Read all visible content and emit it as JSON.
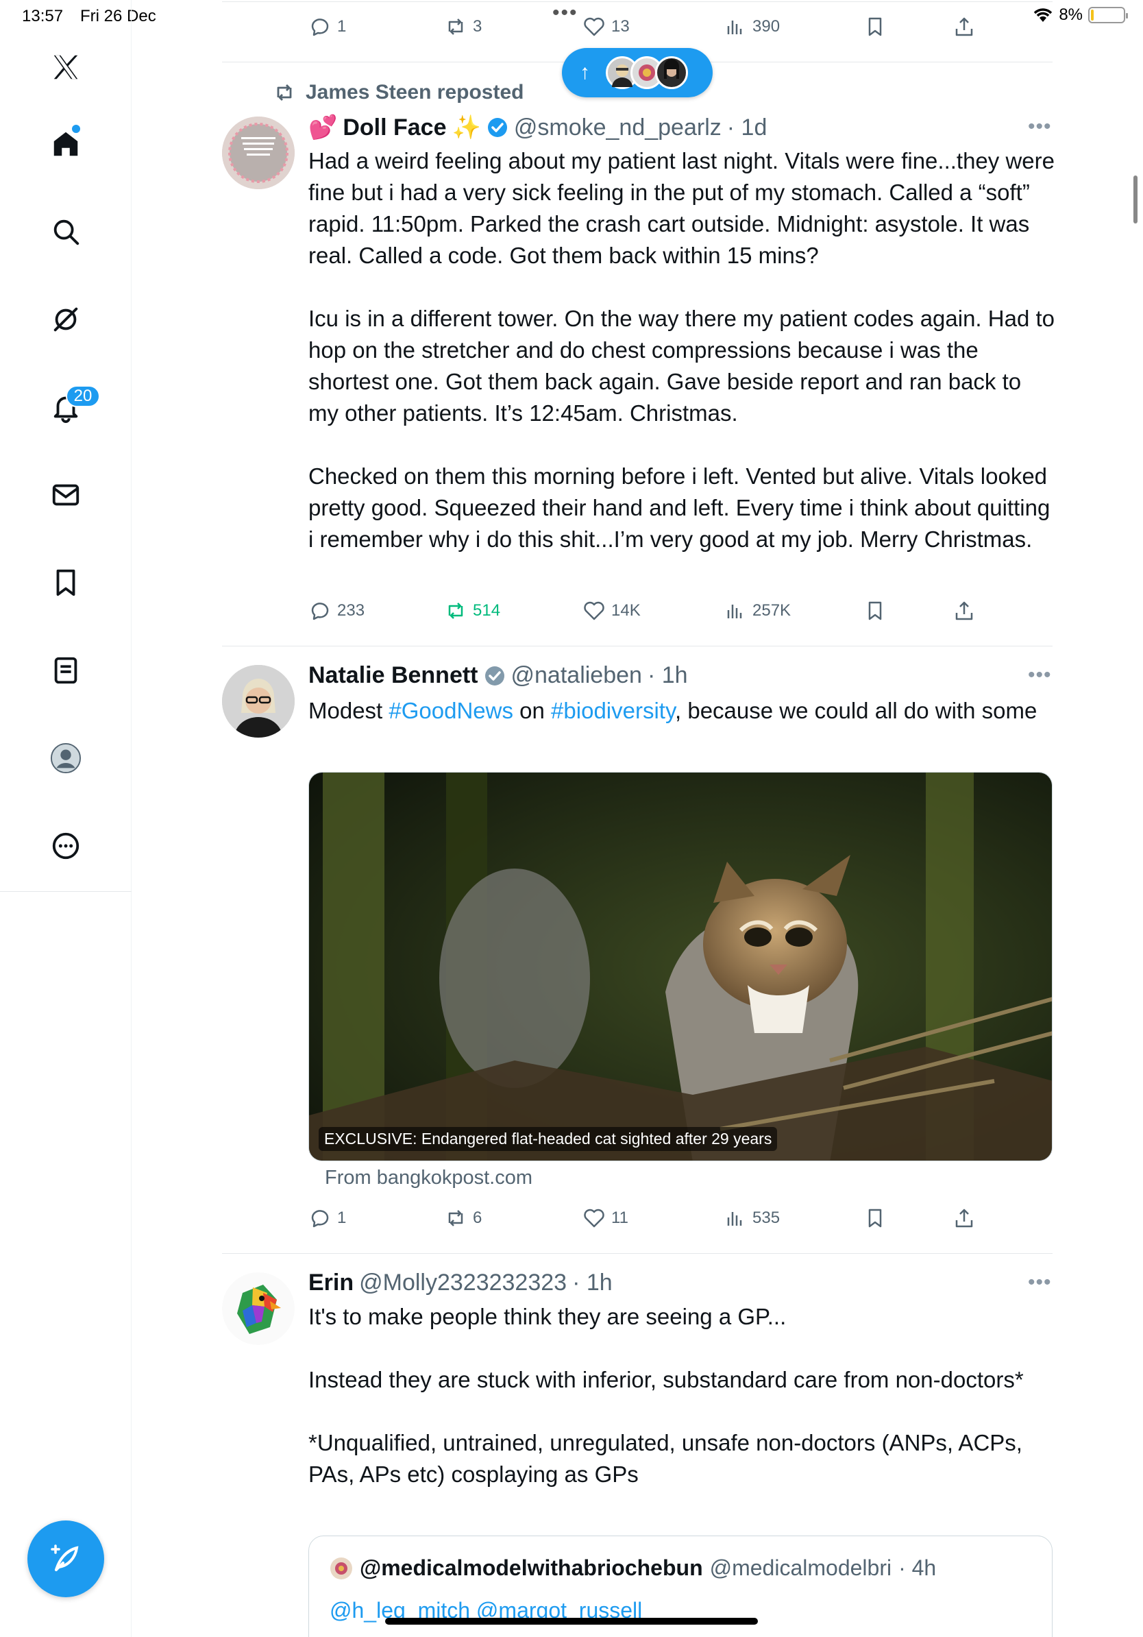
{
  "status_bar": {
    "time": "13:57",
    "date": "Fri 26 Dec",
    "battery": "8%",
    "battery_fraction": 0.08
  },
  "sidebar": {
    "items": [
      {
        "name": "x-logo-icon"
      },
      {
        "name": "home-icon"
      },
      {
        "name": "search-icon"
      },
      {
        "name": "grok-icon"
      },
      {
        "name": "notifications-icon",
        "badge": "20"
      },
      {
        "name": "messages-icon"
      },
      {
        "name": "bookmarks-icon"
      },
      {
        "name": "lists-icon"
      },
      {
        "name": "profile-icon"
      },
      {
        "name": "more-icon"
      }
    ]
  },
  "top_actions": {
    "replies": "1",
    "reposts": "3",
    "likes": "13",
    "views": "390"
  },
  "new_posts_pill": {
    "arrow": "↑"
  },
  "tweets": [
    {
      "repost_by": "James Steen reposted",
      "name_prefix": "💕",
      "name": "Doll Face",
      "name_suffix": "✨",
      "handle": "@smoke_nd_pearlz",
      "time": "· 1d",
      "verified": true,
      "text": "Had a weird feeling about my patient last night. Vitals were fine...they were fine but i had a very sick feeling in the put of my stomach. Called a “soft” rapid. 11:50pm. Parked the crash cart outside. Midnight: asystole. It was real. Called a code. Got them back within 15 mins?\n\nIcu is in a different tower. On the way there my patient codes again. Had to hop on the stretcher and do chest compressions because i was the shortest one. Got them back again. Gave beside report and ran back to my other patients. It’s 12:45am. Christmas.\n\nChecked on them this morning before i left. Vented but alive. Vitals looked pretty good. Squeezed their hand and left. Every time i think about quitting i remember why i do this shit...I’m very good at my job. Merry Christmas.",
      "replies": "233",
      "reposts": "514",
      "likes": "14K",
      "views": "257K"
    },
    {
      "name": "Natalie Bennett",
      "handle": "@natalieben",
      "time": "· 1h",
      "verified": true,
      "text_parts": [
        "Modest ",
        "#GoodNews",
        " on ",
        "#biodiversity",
        ", because we could all do with some"
      ],
      "media_caption": "EXCLUSIVE: Endangered flat-headed cat sighted after 29 years",
      "source": "From bangkokpost.com",
      "replies": "1",
      "reposts": "6",
      "likes": "11",
      "views": "535"
    },
    {
      "name": "Erin",
      "handle": "@Molly2323232323",
      "time": "· 1h",
      "verified": false,
      "text": "It's to make people think they are seeing a GP...\n\nInstead they are stuck with inferior, substandard care from non-doctors*\n\n*Unqualified, untrained, unregulated, unsafe non-doctors (ANPs, ACPs, PAs, APs etc) cosplaying as GPs",
      "quote": {
        "name": "@medicalmodelwithabriochebun",
        "handle": "@medicalmodelbri",
        "time": "· 4h",
        "mentions": "@h_leg_mitch @margot_russell"
      }
    }
  ],
  "more_label": "•••"
}
